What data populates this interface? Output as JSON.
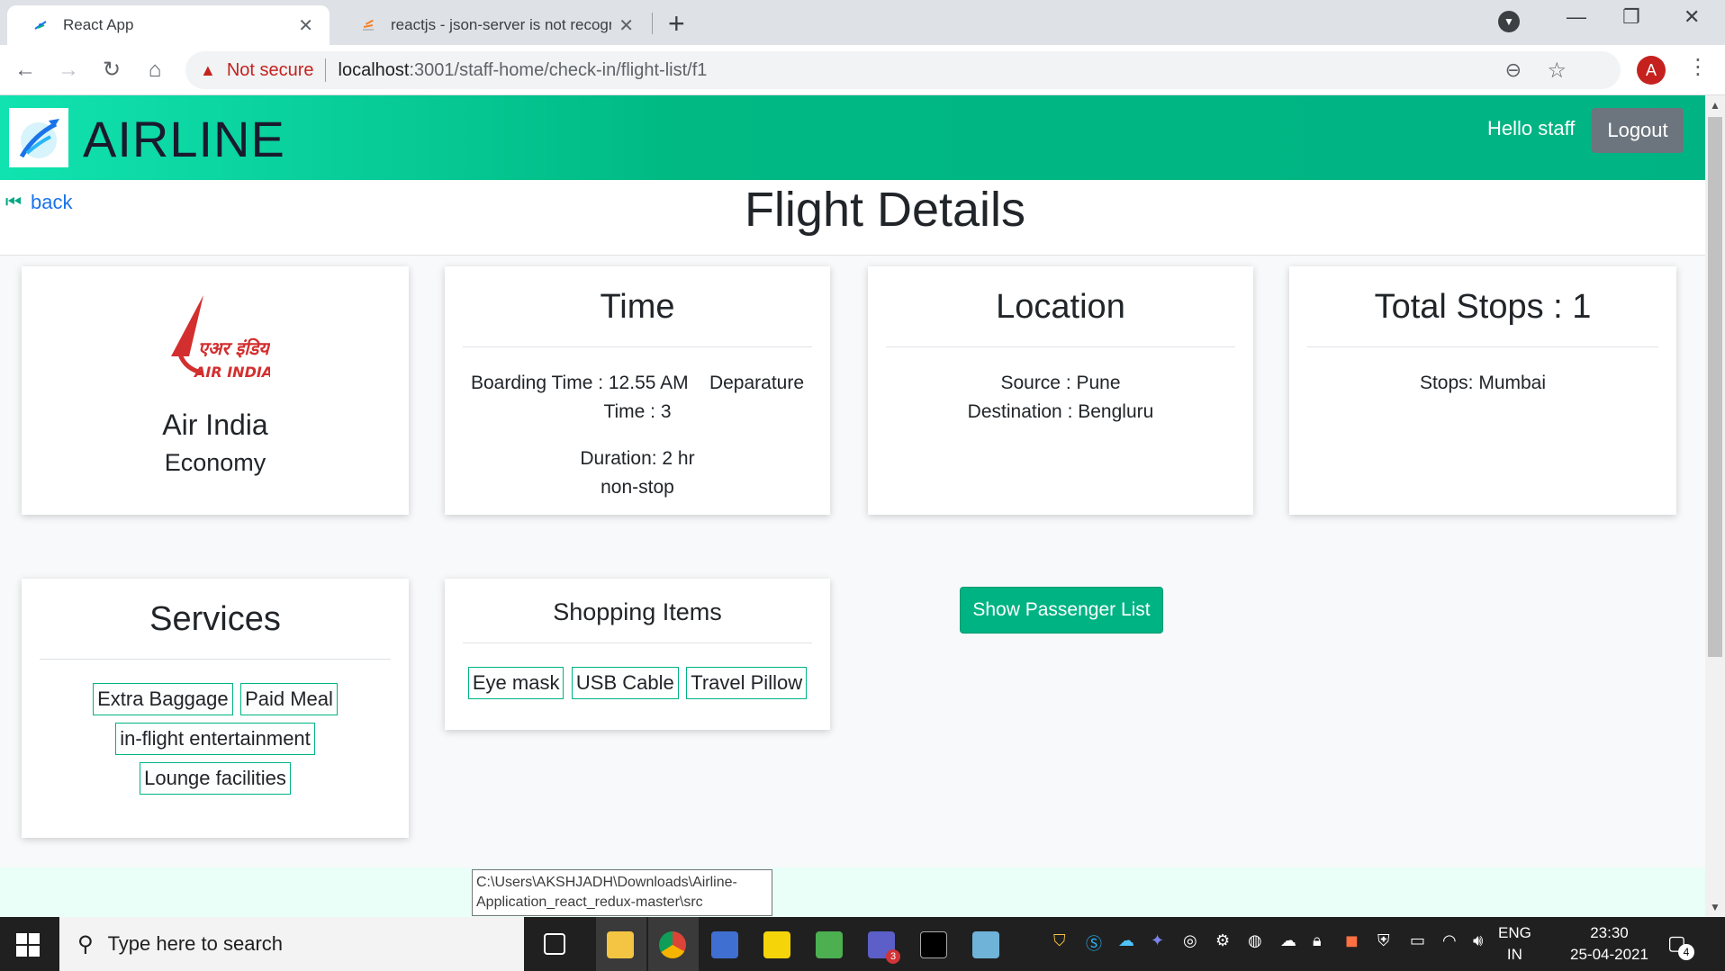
{
  "browser": {
    "tabs": [
      {
        "title": "React App",
        "active": true
      },
      {
        "title": "reactjs - json-server is not recogn",
        "active": false
      }
    ],
    "security_label": "Not secure",
    "url_host": "localhost",
    "url_path": ":3001/staff-home/check-in/flight-list/f1",
    "profile_initial": "A"
  },
  "app": {
    "brand": "AIRLINE",
    "greeting": "Hello staff",
    "logout_label": "Logout",
    "back_label": "back",
    "page_title": "Flight Details"
  },
  "airline_card": {
    "logo_text_hindi": "एअर इंडिया",
    "logo_text": "AIR INDIA",
    "name": "Air India",
    "class": "Economy"
  },
  "time_card": {
    "title": "Time",
    "line1": "Boarding Time : 12.55 AM    Deparature",
    "line2": "Time : 3",
    "line3": "Duration: 2 hr",
    "line4": "non-stop"
  },
  "location_card": {
    "title": "Location",
    "source": "Source : Pune",
    "destination": "Destination : Bengluru"
  },
  "stops_card": {
    "title": "Total Stops : 1",
    "stops": "Stops: Mumbai"
  },
  "services_card": {
    "title": "Services",
    "items": [
      "Extra Baggage",
      "Paid Meal",
      "in-flight entertainment",
      "Lounge facilities"
    ]
  },
  "shopping_card": {
    "title": "Shopping Items",
    "items": [
      "Eye mask",
      "USB Cable",
      "Travel Pillow"
    ]
  },
  "show_passenger_label": "Show Passenger List",
  "tooltip": {
    "line1": "C:\\Users\\AKSHJADH\\Downloads\\Airline-",
    "line2": "Application_react_redux-master\\src"
  },
  "taskbar": {
    "search_placeholder": "Type here to search",
    "lang_top": "ENG",
    "lang_bottom": "IN",
    "time": "23:30",
    "date": "25-04-2021",
    "notification_count": "4",
    "teams_badge": "3"
  },
  "colors": {
    "brand_green": "#00b383",
    "warning_red": "#c5221f",
    "logout_gray": "#6c757d"
  }
}
